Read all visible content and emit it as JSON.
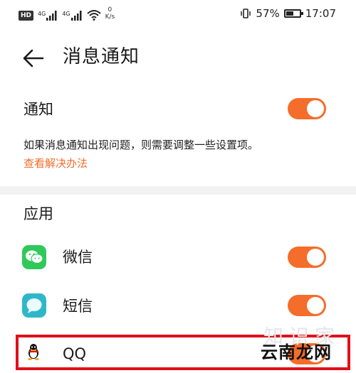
{
  "status_bar": {
    "hd_badge": "HD",
    "sim1_label": "4G",
    "sim2_label": "4G",
    "net_speed_value": "0",
    "net_speed_unit": "K/s",
    "battery_percent": "57%",
    "battery_level": 0.57,
    "time": "17:07"
  },
  "header": {
    "title": "消息通知"
  },
  "notification": {
    "label": "通知",
    "enabled": true,
    "description": "如果消息通知出现问题，则需要调整一些设置项。",
    "help_link": "查看解决办法"
  },
  "apps_section": {
    "title": "应用",
    "items": [
      {
        "name": "微信",
        "icon": "wechat-icon",
        "enabled": true
      },
      {
        "name": "短信",
        "icon": "messages-icon",
        "enabled": true
      },
      {
        "name": "QQ",
        "icon": "qq-penguin-icon",
        "enabled": true
      }
    ]
  },
  "watermark": {
    "text": "云南龙网",
    "ghost_text": "知识家"
  },
  "colors": {
    "accent": "#f46d2a",
    "highlight": "#e0101a",
    "wechat_green": "#2fc95a",
    "messages_teal": "#2fb7c8"
  }
}
